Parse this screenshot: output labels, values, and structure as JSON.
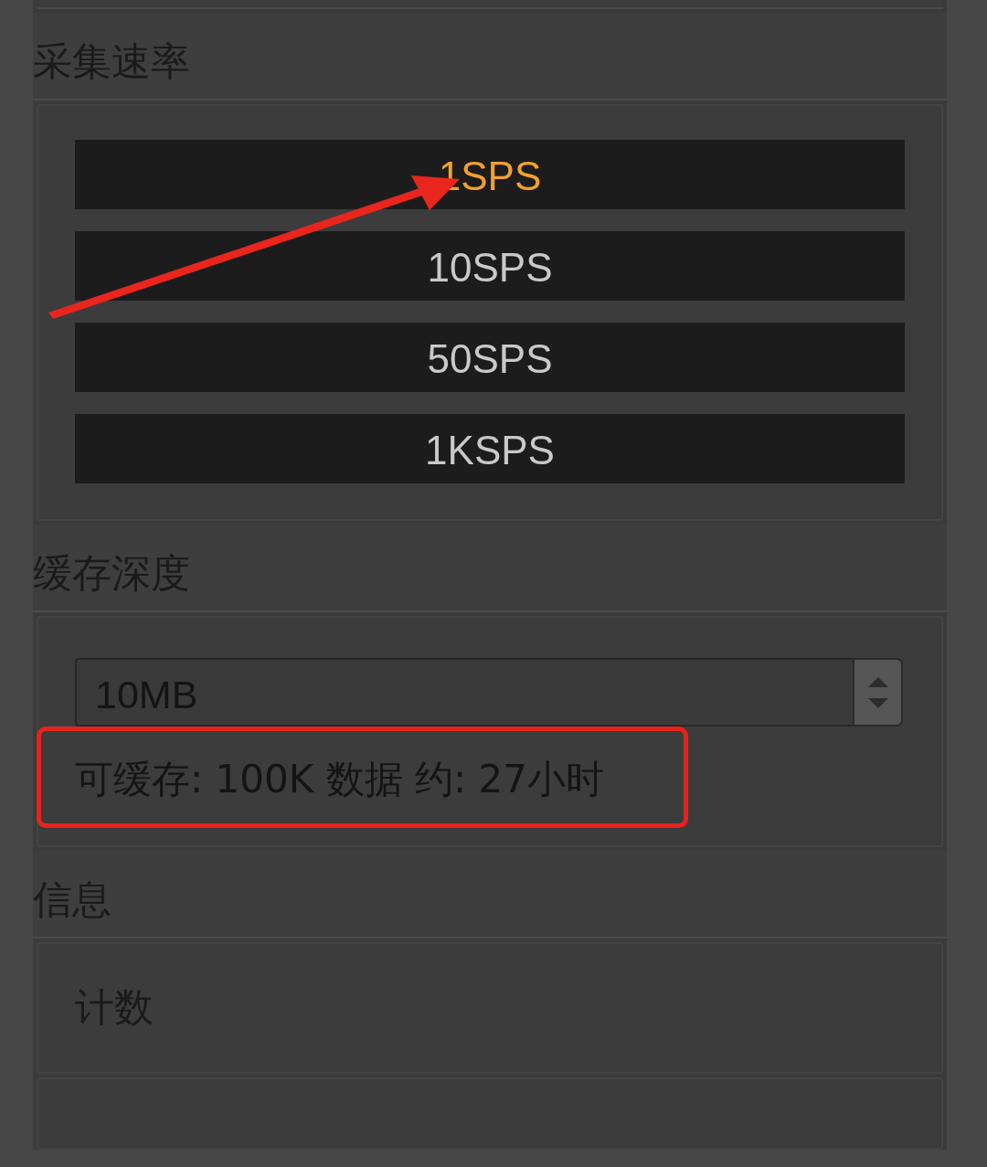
{
  "sections": [
    {
      "title": "采集速率",
      "kind": "options",
      "options": [
        {
          "label": "1SPS",
          "selected": true
        },
        {
          "label": "10SPS",
          "selected": false
        },
        {
          "label": "50SPS",
          "selected": false
        },
        {
          "label": "1KSPS",
          "selected": false
        }
      ]
    },
    {
      "title": "缓存深度",
      "kind": "spinbox",
      "value": "10MB",
      "note": "可缓存: 100K 数据 约: 27小时"
    },
    {
      "title": "信息",
      "kind": "rows",
      "rows": [
        "计数"
      ]
    }
  ]
}
